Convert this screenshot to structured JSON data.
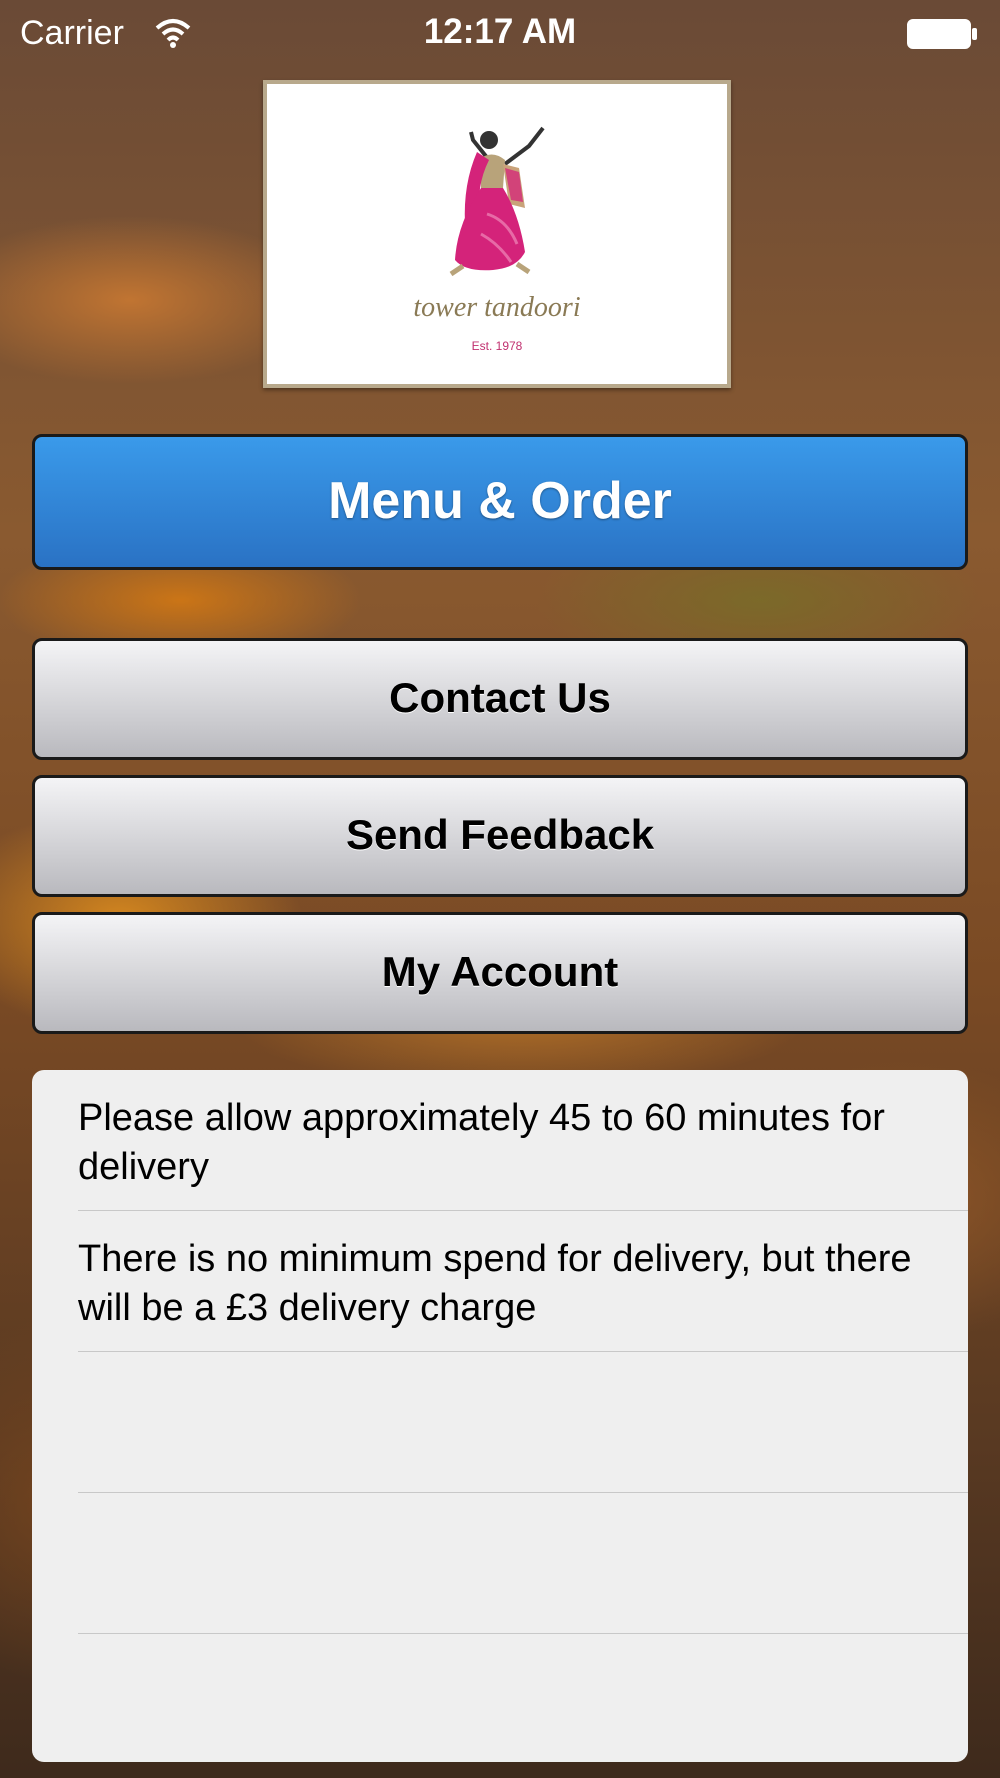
{
  "status_bar": {
    "carrier": "Carrier",
    "time": "12:17 AM"
  },
  "logo": {
    "brand_text": "tower tandoori",
    "established": "Est. 1978",
    "accent_color": "#d4237a"
  },
  "buttons": {
    "menu_order": "Menu & Order",
    "contact_us": "Contact Us",
    "send_feedback": "Send Feedback",
    "my_account": "My Account"
  },
  "info_rows": [
    "Please allow approximately 45 to 60 minutes for delivery",
    "There is no minimum spend for delivery, but there will be a £3 delivery charge",
    "",
    ""
  ],
  "colors": {
    "primary_button": "#2f84d8",
    "secondary_button": "#d6d6da",
    "panel": "#efefef"
  }
}
